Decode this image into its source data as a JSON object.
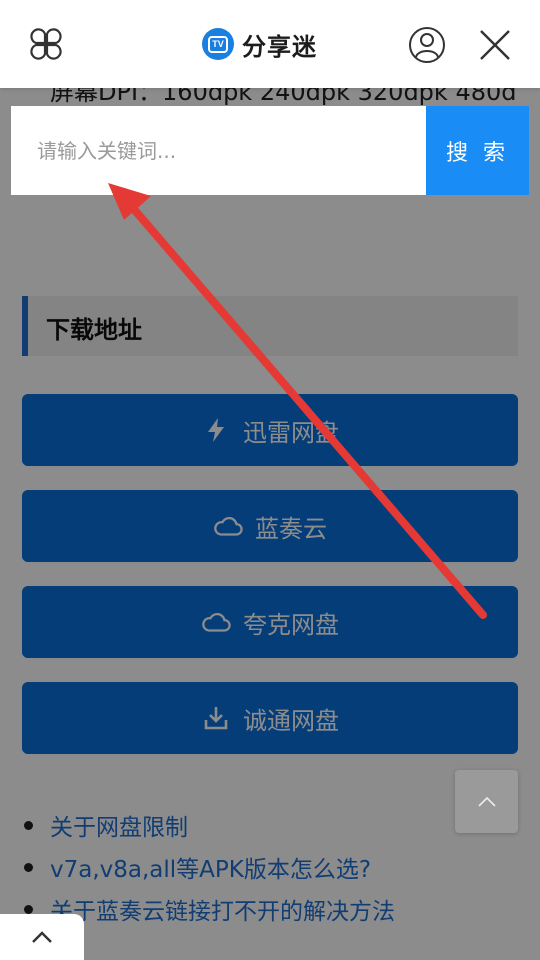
{
  "header": {
    "menu_icon": "four-petal-menu-icon",
    "logo_badge": "TV",
    "logo_text": "分享迷",
    "user_icon": "user-icon",
    "close_icon": "close-icon"
  },
  "peek_text": "屏幕DPI：160dpk 240dpk 320dpk 480d",
  "search": {
    "placeholder": "请输入关键词...",
    "button_label": "搜 索"
  },
  "section": {
    "title": "下载地址"
  },
  "downloads": [
    {
      "label": "迅雷网盘",
      "icon": "lightning-icon"
    },
    {
      "label": "蓝奏云",
      "icon": "cloud-icon"
    },
    {
      "label": "夸克网盘",
      "icon": "cloud-icon"
    },
    {
      "label": "诚通网盘",
      "icon": "download-icon"
    }
  ],
  "links": [
    "关于网盘限制",
    "v7a,v8a,all等APK版本怎么选?",
    "关于蓝奏云链接打不开的解决方法"
  ],
  "colors": {
    "accent": "#0a6fdc",
    "search_button": "#1a8cf5",
    "annotation_arrow": "#e53935"
  }
}
